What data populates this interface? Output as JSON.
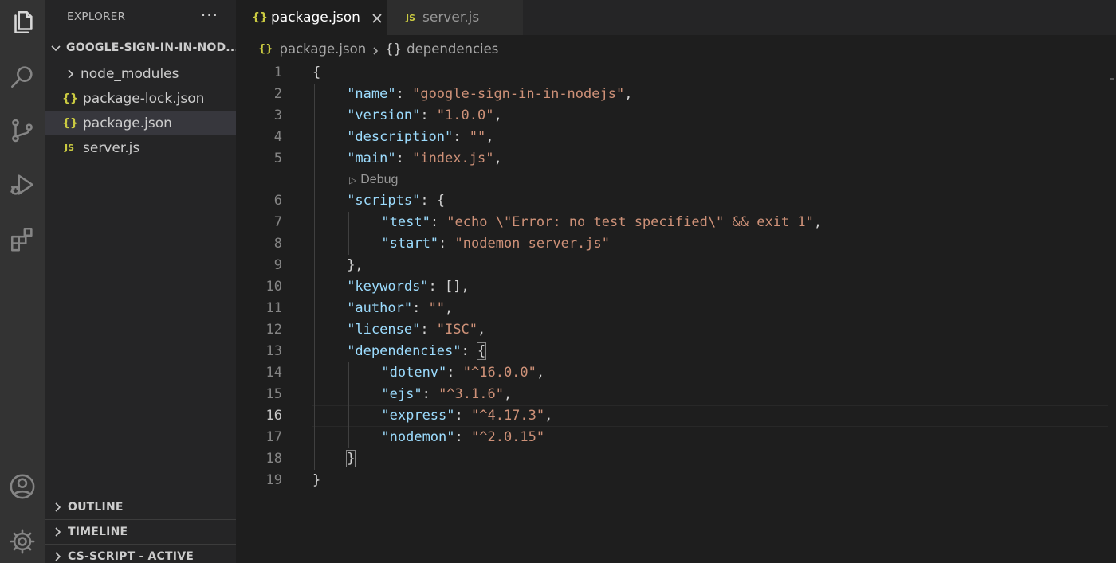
{
  "activity_bar": {
    "items": [
      {
        "icon": "files-icon",
        "active": true
      },
      {
        "icon": "search-icon",
        "active": false
      },
      {
        "icon": "source-control-icon",
        "active": false
      },
      {
        "icon": "run-debug-icon",
        "active": false
      },
      {
        "icon": "extensions-icon",
        "active": false
      }
    ],
    "bottom": [
      {
        "icon": "account-icon"
      },
      {
        "icon": "gear-icon"
      }
    ]
  },
  "sidebar": {
    "title": "EXPLORER",
    "more": "···",
    "folder": "GOOGLE-SIGN-IN-IN-NOD...",
    "items": [
      {
        "label": "node_modules",
        "type": "folder"
      },
      {
        "label": "package-lock.json",
        "type": "json"
      },
      {
        "label": "package.json",
        "type": "json",
        "selected": true
      },
      {
        "label": "server.js",
        "type": "js"
      }
    ],
    "panels": [
      {
        "label": "OUTLINE"
      },
      {
        "label": "TIMELINE"
      },
      {
        "label": "CS-SCRIPT - ACTIVE"
      }
    ]
  },
  "tabs": [
    {
      "label": "package.json",
      "icon": "{}",
      "active": true
    },
    {
      "label": "server.js",
      "icon": "JS",
      "active": false
    }
  ],
  "breadcrumb": {
    "file": "package.json",
    "file_icon": "{}",
    "symbol_icon": "{}",
    "symbol": "dependencies"
  },
  "editor": {
    "code_lens": "Debug",
    "current_line": 16,
    "line_numbers": [
      "1",
      "2",
      "3",
      "4",
      "5",
      "6",
      "7",
      "8",
      "9",
      "10",
      "11",
      "12",
      "13",
      "14",
      "15",
      "16",
      "17",
      "18",
      "19"
    ],
    "lines": [
      {
        "n": 1,
        "indent": 0,
        "tokens": [
          [
            "p",
            "{"
          ]
        ]
      },
      {
        "n": 2,
        "indent": 1,
        "tokens": [
          [
            "k",
            "\"name\""
          ],
          [
            "p",
            ": "
          ],
          [
            "s",
            "\"google-sign-in-in-nodejs\""
          ],
          [
            "p",
            ","
          ]
        ]
      },
      {
        "n": 3,
        "indent": 1,
        "tokens": [
          [
            "k",
            "\"version\""
          ],
          [
            "p",
            ": "
          ],
          [
            "s",
            "\"1.0.0\""
          ],
          [
            "p",
            ","
          ]
        ]
      },
      {
        "n": 4,
        "indent": 1,
        "tokens": [
          [
            "k",
            "\"description\""
          ],
          [
            "p",
            ": "
          ],
          [
            "s",
            "\"\""
          ],
          [
            "p",
            ","
          ]
        ]
      },
      {
        "n": 5,
        "indent": 1,
        "tokens": [
          [
            "k",
            "\"main\""
          ],
          [
            "p",
            ": "
          ],
          [
            "s",
            "\"index.js\""
          ],
          [
            "p",
            ","
          ]
        ]
      },
      {
        "n": 6,
        "indent": 1,
        "tokens": [
          [
            "k",
            "\"scripts\""
          ],
          [
            "p",
            ": {"
          ]
        ]
      },
      {
        "n": 7,
        "indent": 2,
        "tokens": [
          [
            "k",
            "\"test\""
          ],
          [
            "p",
            ": "
          ],
          [
            "s",
            "\"echo \\\"Error: no test specified\\\" && exit 1\""
          ],
          [
            "p",
            ","
          ]
        ]
      },
      {
        "n": 8,
        "indent": 2,
        "tokens": [
          [
            "k",
            "\"start\""
          ],
          [
            "p",
            ": "
          ],
          [
            "s",
            "\"nodemon server.js\""
          ]
        ]
      },
      {
        "n": 9,
        "indent": 1,
        "tokens": [
          [
            "p",
            "},"
          ]
        ]
      },
      {
        "n": 10,
        "indent": 1,
        "tokens": [
          [
            "k",
            "\"keywords\""
          ],
          [
            "p",
            ": [],"
          ]
        ]
      },
      {
        "n": 11,
        "indent": 1,
        "tokens": [
          [
            "k",
            "\"author\""
          ],
          [
            "p",
            ": "
          ],
          [
            "s",
            "\"\""
          ],
          [
            "p",
            ","
          ]
        ]
      },
      {
        "n": 12,
        "indent": 1,
        "tokens": [
          [
            "k",
            "\"license\""
          ],
          [
            "p",
            ": "
          ],
          [
            "s",
            "\"ISC\""
          ],
          [
            "p",
            ","
          ]
        ]
      },
      {
        "n": 13,
        "indent": 1,
        "tokens": [
          [
            "k",
            "\"dependencies\""
          ],
          [
            "p",
            ": "
          ],
          [
            "b",
            "{"
          ]
        ]
      },
      {
        "n": 14,
        "indent": 2,
        "tokens": [
          [
            "k",
            "\"dotenv\""
          ],
          [
            "p",
            ": "
          ],
          [
            "s",
            "\"^16.0.0\""
          ],
          [
            "p",
            ","
          ]
        ]
      },
      {
        "n": 15,
        "indent": 2,
        "tokens": [
          [
            "k",
            "\"ejs\""
          ],
          [
            "p",
            ": "
          ],
          [
            "s",
            "\"^3.1.6\""
          ],
          [
            "p",
            ","
          ]
        ]
      },
      {
        "n": 16,
        "indent": 2,
        "tokens": [
          [
            "k",
            "\"express\""
          ],
          [
            "p",
            ": "
          ],
          [
            "s",
            "\"^4.17.3\""
          ],
          [
            "p",
            ","
          ]
        ]
      },
      {
        "n": 17,
        "indent": 2,
        "tokens": [
          [
            "k",
            "\"nodemon\""
          ],
          [
            "p",
            ": "
          ],
          [
            "s",
            "\"^2.0.15\""
          ]
        ]
      },
      {
        "n": 18,
        "indent": 1,
        "tokens": [
          [
            "b",
            "}"
          ]
        ]
      },
      {
        "n": 19,
        "indent": 0,
        "tokens": [
          [
            "p",
            "}"
          ]
        ]
      }
    ]
  },
  "colors": {
    "key": "#9cdcfe",
    "string": "#ce9178",
    "punctuation": "#d4d4d4",
    "json_icon": "#cbcb41"
  }
}
